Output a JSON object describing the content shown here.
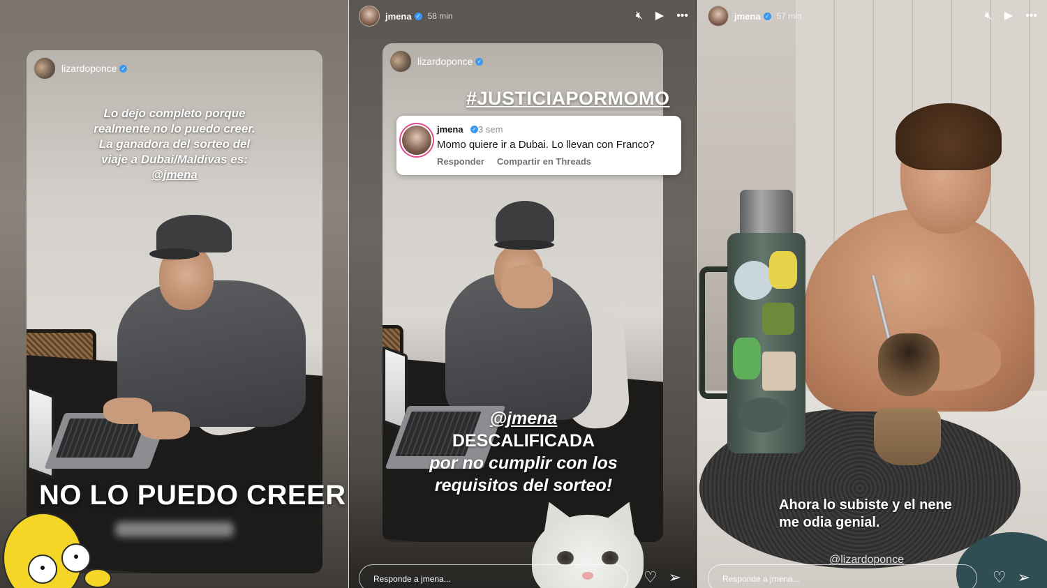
{
  "story1": {
    "card_username": "lizardoponce",
    "caption_lines": [
      "Lo dejo completo porque",
      "realmente no lo puedo creer.",
      "La ganadora del sorteo del",
      "viaje a Dubai/Maldivas es:"
    ],
    "caption_mention": "@jmena",
    "title": "NO LO PUEDO CREER"
  },
  "story2": {
    "username": "jmena",
    "time": "58 min",
    "card_username": "lizardoponce",
    "hashtag": "#JUSTICIAPORMOMO",
    "comment": {
      "user": "jmena",
      "time": "3 sem",
      "text": "Momo quiere ir a Dubai. Lo llevan con Franco?",
      "reply_label": "Responder",
      "share_label": "Compartir en Threads"
    },
    "caption_mention": "@jmena",
    "caption_lines": [
      "DESCALIFICADA",
      "por no cumplir con los",
      "requisitos del sorteo!"
    ],
    "reply_placeholder": "Responde a jmena..."
  },
  "story3": {
    "username": "jmena",
    "time": "57 min",
    "caption_lines": [
      "Ahora lo subiste y el nene",
      "me odia genial."
    ],
    "mention": "@lizardoponce",
    "reply_placeholder": "Responde a jmena..."
  },
  "icons": {
    "mute": "mute-icon",
    "play": "play-icon",
    "more": "more-icon",
    "like": "heart-icon",
    "send": "send-icon",
    "verified": "verified-badge-icon"
  },
  "colors": {
    "verified": "#3b97f0",
    "comment_ring": "#e24d8e"
  }
}
